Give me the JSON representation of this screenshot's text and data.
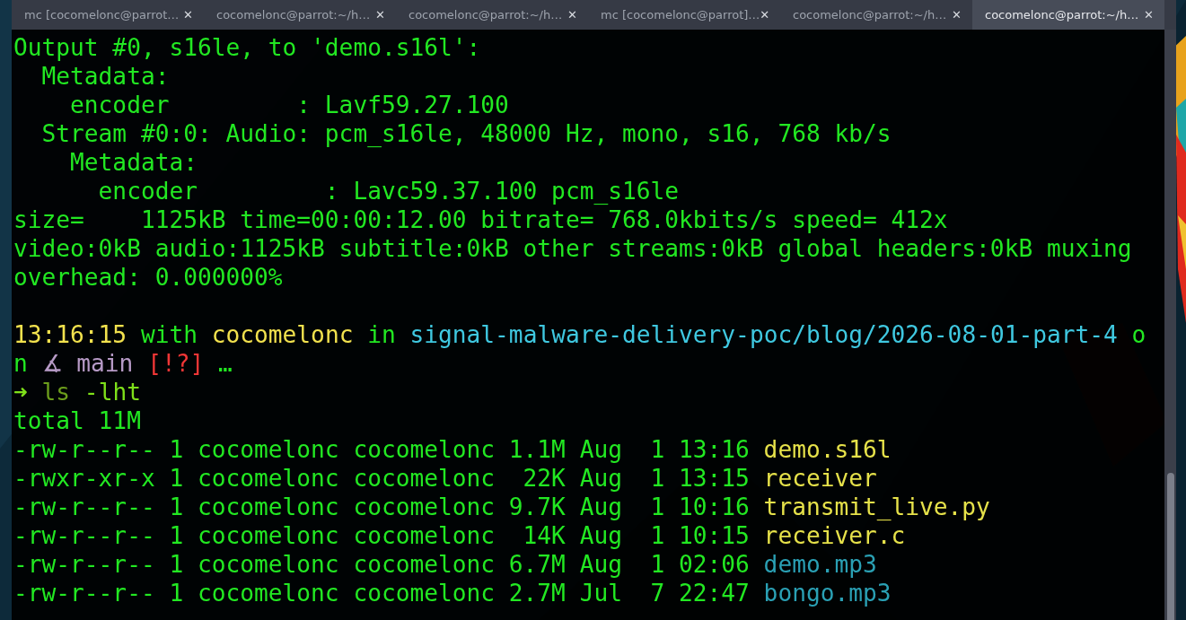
{
  "tabs": [
    {
      "label": "mc [cocomelonc@parrot…",
      "selected": false,
      "close": "✕"
    },
    {
      "label": "cocomelonc@parrot:~/h…",
      "selected": false,
      "close": "✕"
    },
    {
      "label": "cocomelonc@parrot:~/h…",
      "selected": false,
      "close": "✕"
    },
    {
      "label": "mc [cocomelonc@parrot]…",
      "selected": false,
      "close": "✕"
    },
    {
      "label": "cocomelonc@parrot:~/h…",
      "selected": false,
      "close": "✕"
    },
    {
      "label": "cocomelonc@parrot:~/h…",
      "selected": true,
      "close": "✕"
    }
  ],
  "terminal": {
    "blocks": [
      {
        "lines": [
          [
            {
              "text": "Output #0, s16le, to 'demo.s16l':",
              "color": "#22e822"
            }
          ],
          [
            {
              "text": "  Metadata:",
              "color": "#22e822"
            }
          ],
          [
            {
              "text": "    encoder         : Lavf59.27.100",
              "color": "#22e822"
            }
          ],
          [
            {
              "text": "  Stream #0:0: Audio: pcm_s16le, 48000 Hz, mono, s16, 768 kb/s",
              "color": "#22e822"
            }
          ],
          [
            {
              "text": "    Metadata:",
              "color": "#22e822"
            }
          ],
          [
            {
              "text": "      encoder         : Lavc59.37.100 pcm_s16le",
              "color": "#22e822"
            }
          ],
          [
            {
              "text": "size=    1125kB time=00:00:12.00 bitrate= 768.0kbits/s speed= 412x",
              "color": "#22e822"
            }
          ],
          [
            {
              "text": "video:0kB audio:1125kB subtitle:0kB other streams:0kB global headers:0kB muxing",
              "color": "#22e822"
            }
          ],
          [
            {
              "text": "overhead: 0.000000%",
              "color": "#22e822"
            }
          ]
        ]
      },
      {
        "lines": [
          [
            {
              "text": "13:16:15",
              "color": "#f2e24e"
            },
            {
              "text": " with ",
              "color": "#22e822"
            },
            {
              "text": "cocomelonc",
              "color": "#f2e24e"
            },
            {
              "text": " in ",
              "color": "#22e822"
            },
            {
              "text": "signal-malware-delivery-poc/blog/2026-08-01-part-4",
              "color": "#3fc8e0"
            },
            {
              "text": " o",
              "color": "#22e822"
            }
          ],
          [
            {
              "text": "n ",
              "color": "#22e822"
            },
            {
              "text": "∡ main",
              "color": "#b69ac6"
            },
            {
              "text": " [!?]",
              "color": "#f03636"
            },
            {
              "text": " …",
              "color": "#22e822"
            }
          ],
          [
            {
              "text": "➜ ",
              "color": "#7ee01a"
            },
            {
              "text": "ls",
              "color": "#6c9e1c"
            },
            {
              "text": " -lht",
              "color": "#7ee01a"
            }
          ],
          [
            {
              "text": "total 11M",
              "color": "#22e822"
            }
          ],
          [
            {
              "text": "-rw-r--r-- 1 cocomelonc cocomelonc 1.1M Aug  1 13:16 ",
              "color": "#22e822"
            },
            {
              "text": "demo.s16l",
              "color": "#e6e24a"
            }
          ],
          [
            {
              "text": "-rwxr-xr-x 1 cocomelonc cocomelonc  22K Aug  1 13:15 ",
              "color": "#22e822"
            },
            {
              "text": "receiver",
              "color": "#e6e24a"
            }
          ],
          [
            {
              "text": "-rw-r--r-- 1 cocomelonc cocomelonc 9.7K Aug  1 10:16 ",
              "color": "#22e822"
            },
            {
              "text": "transmit_live.py",
              "color": "#e6e24a"
            }
          ],
          [
            {
              "text": "-rw-r--r-- 1 cocomelonc cocomelonc  14K Aug  1 10:15 ",
              "color": "#22e822"
            },
            {
              "text": "receiver.c",
              "color": "#e6e24a"
            }
          ],
          [
            {
              "text": "-rw-r--r-- 1 cocomelonc cocomelonc 6.7M Aug  1 02:06 ",
              "color": "#22e822"
            },
            {
              "text": "demo.mp3",
              "color": "#2aa0b4"
            }
          ],
          [
            {
              "text": "-rw-r--r-- 1 cocomelonc cocomelonc 2.7M Jul  7 22:47 ",
              "color": "#22e822"
            },
            {
              "text": "bongo.mp3",
              "color": "#2aa0b4"
            }
          ]
        ]
      }
    ]
  }
}
